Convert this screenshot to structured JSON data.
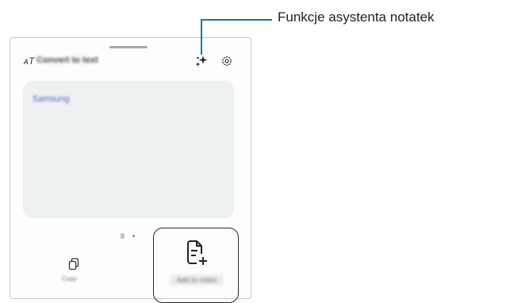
{
  "panel": {
    "toolbar": {
      "convert_icon_glyph": "ᴀT",
      "title": "Convert to text",
      "assistant_icon": "sparkle-icon",
      "settings_icon": "gear-icon"
    },
    "card": {
      "text": "Samsung"
    },
    "bottom_bar": {
      "copy_icon": "copy-icon",
      "copy_label": "Copy",
      "add_note_icon": "note-add-icon",
      "add_note_label": "Add to notes"
    }
  },
  "callout": {
    "label": "Funkcje asystenta notatek"
  },
  "colors": {
    "callout_line": "#1a76a7",
    "card_bg": "#eef1f1",
    "card_text": "#5566c4"
  }
}
